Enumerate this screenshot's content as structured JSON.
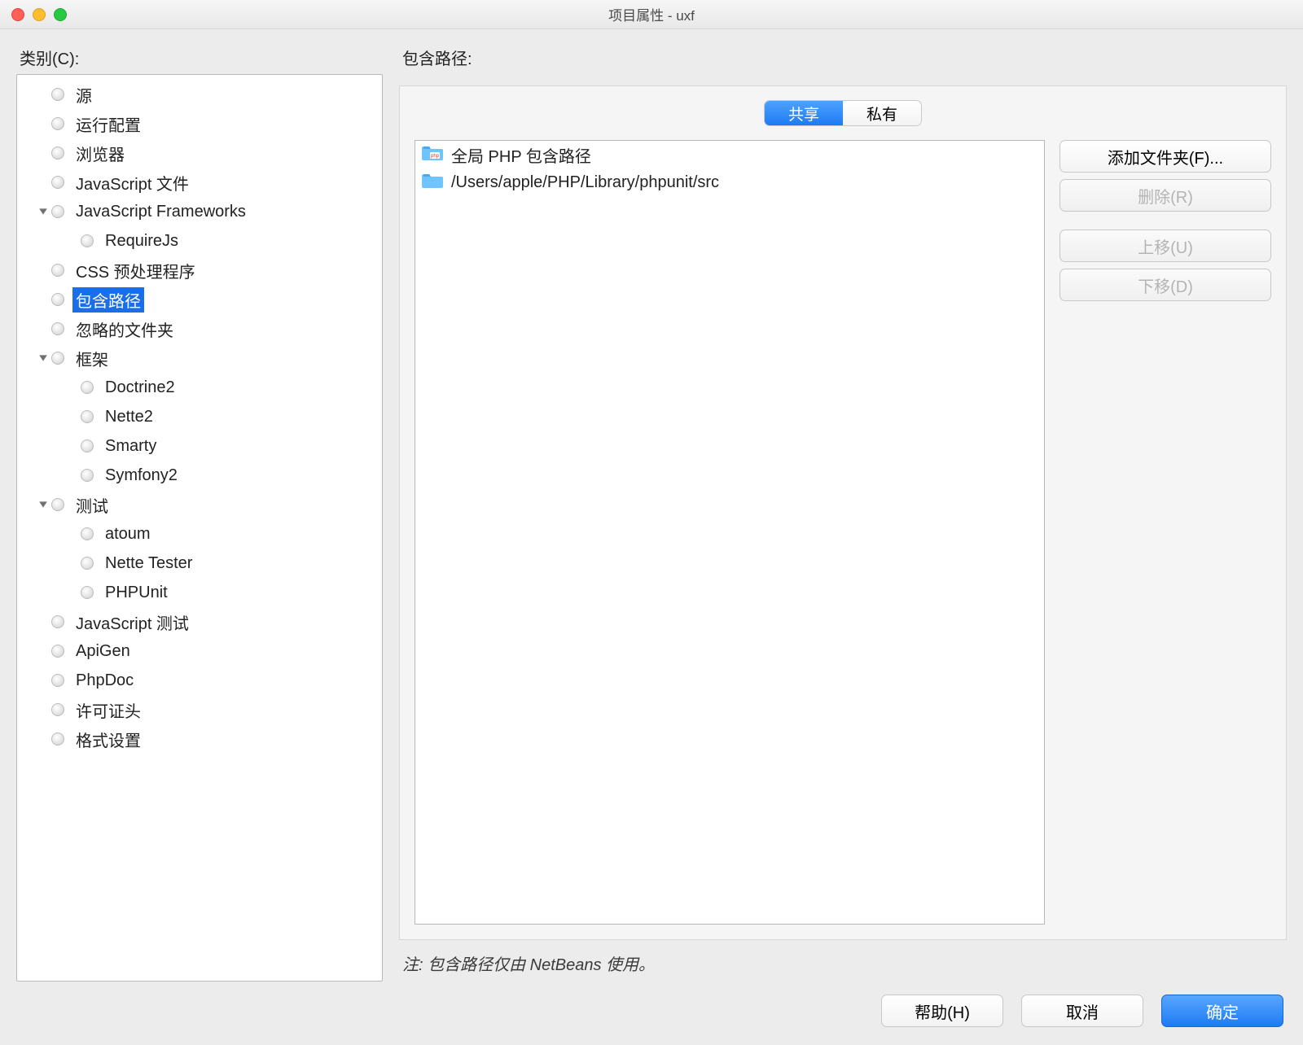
{
  "window": {
    "title": "项目属性 - uxf"
  },
  "left": {
    "label": "类别(C):"
  },
  "tree": [
    {
      "indent": 0,
      "expander": "none",
      "label": "源"
    },
    {
      "indent": 0,
      "expander": "none",
      "label": "运行配置"
    },
    {
      "indent": 0,
      "expander": "none",
      "label": "浏览器"
    },
    {
      "indent": 0,
      "expander": "none",
      "label": "JavaScript 文件"
    },
    {
      "indent": 0,
      "expander": "open",
      "label": "JavaScript Frameworks"
    },
    {
      "indent": 1,
      "expander": "none",
      "label": "RequireJs"
    },
    {
      "indent": 0,
      "expander": "none",
      "label": "CSS 预处理程序"
    },
    {
      "indent": 0,
      "expander": "none",
      "label": "包含路径",
      "selected": true
    },
    {
      "indent": 0,
      "expander": "none",
      "label": "忽略的文件夹"
    },
    {
      "indent": 0,
      "expander": "open",
      "label": "框架"
    },
    {
      "indent": 1,
      "expander": "none",
      "label": "Doctrine2"
    },
    {
      "indent": 1,
      "expander": "none",
      "label": "Nette2"
    },
    {
      "indent": 1,
      "expander": "none",
      "label": "Smarty"
    },
    {
      "indent": 1,
      "expander": "none",
      "label": "Symfony2"
    },
    {
      "indent": 0,
      "expander": "open",
      "label": "测试"
    },
    {
      "indent": 1,
      "expander": "none",
      "label": "atoum"
    },
    {
      "indent": 1,
      "expander": "none",
      "label": "Nette Tester"
    },
    {
      "indent": 1,
      "expander": "none",
      "label": "PHPUnit"
    },
    {
      "indent": 0,
      "expander": "none",
      "label": "JavaScript 测试"
    },
    {
      "indent": 0,
      "expander": "none",
      "label": "ApiGen"
    },
    {
      "indent": 0,
      "expander": "none",
      "label": "PhpDoc"
    },
    {
      "indent": 0,
      "expander": "none",
      "label": "许可证头"
    },
    {
      "indent": 0,
      "expander": "none",
      "label": "格式设置"
    }
  ],
  "right": {
    "title": "包含路径:",
    "seg": {
      "shared": "共享",
      "private": "私有"
    },
    "paths": [
      {
        "icon": "php-folder",
        "label": "全局 PHP 包含路径"
      },
      {
        "icon": "folder",
        "label": "/Users/apple/PHP/Library/phpunit/src"
      }
    ],
    "buttons": {
      "add": "添加文件夹(F)...",
      "remove": "删除(R)",
      "up": "上移(U)",
      "down": "下移(D)"
    },
    "note": "注: 包含路径仅由 NetBeans 使用。"
  },
  "footer": {
    "help": "帮助(H)",
    "cancel": "取消",
    "ok": "确定"
  }
}
